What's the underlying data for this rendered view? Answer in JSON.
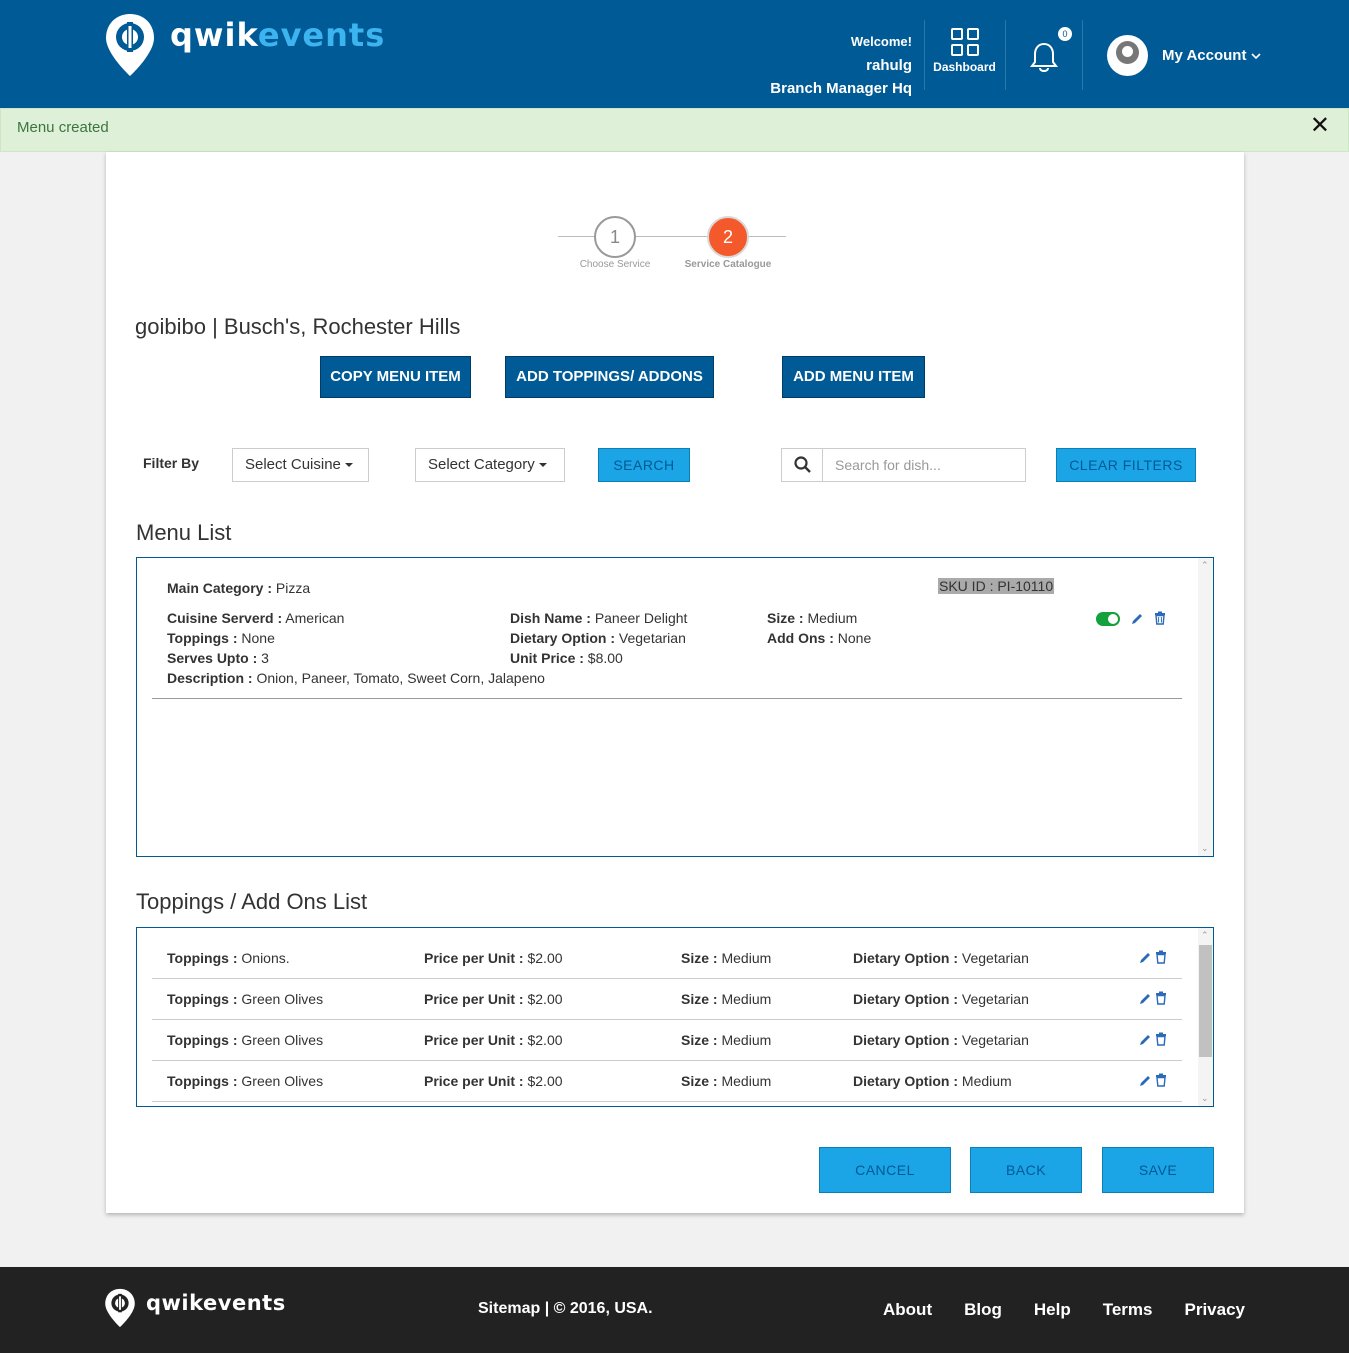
{
  "brand": {
    "name_part1": "qwik",
    "name_part2": "events"
  },
  "header": {
    "welcome": "Welcome!",
    "username": "rahulg",
    "role": "Branch Manager Hq",
    "dashboard_label": "Dashboard",
    "notification_count": "0",
    "account_label": "My Account"
  },
  "alert": {
    "message": "Menu created",
    "close": "✕"
  },
  "steps": [
    {
      "number": "1",
      "label": "Choose Service"
    },
    {
      "number": "2",
      "label": "Service Catalogue"
    }
  ],
  "page_title": "goibibo | Busch's, Rochester Hills",
  "actions": {
    "copy": "COPY MENU ITEM",
    "toppings": "ADD TOPPINGS/ ADDONS",
    "add": "ADD MENU ITEM"
  },
  "filters": {
    "label": "Filter By",
    "cuisine": "Select Cuisine",
    "category": "Select Category",
    "search_btn": "SEARCH",
    "search_placeholder": "Search for dish...",
    "clear": "CLEAR FILTERS"
  },
  "menu_list": {
    "title": "Menu List",
    "item": {
      "main_category_label": "Main Category :",
      "main_category": "Pizza",
      "sku": "SKU ID : PI-10110",
      "cuisine_label": "Cuisine Serverd :",
      "cuisine": "American",
      "toppings_label": "Toppings :",
      "toppings": "None",
      "serves_label": "Serves Upto :",
      "serves": "3",
      "description_label": "Description :",
      "description": "Onion, Paneer, Tomato, Sweet Corn, Jalapeno",
      "dish_label": "Dish Name :",
      "dish": "Paneer Delight",
      "dietary_label": "Dietary Option :",
      "dietary": "Vegetarian",
      "price_label": "Unit Price :",
      "price": "$8.00",
      "size_label": "Size :",
      "size": "Medium",
      "addons_label": "Add Ons :",
      "addons": "None",
      "enabled": true
    }
  },
  "toppings_list": {
    "title": "Toppings / Add Ons List",
    "labels": {
      "topping": "Toppings :",
      "price": "Price per Unit :",
      "size": "Size :",
      "dietary": "Dietary Option :"
    },
    "rows": [
      {
        "topping": "Onions.",
        "price": "$2.00",
        "size": "Medium",
        "dietary": "Vegetarian"
      },
      {
        "topping": "Green Olives",
        "price": "$2.00",
        "size": "Medium",
        "dietary": "Vegetarian"
      },
      {
        "topping": "Green Olives",
        "price": "$2.00",
        "size": "Medium",
        "dietary": "Vegetarian"
      },
      {
        "topping": "Green Olives",
        "price": "$2.00",
        "size": "Medium",
        "dietary": "Medium"
      }
    ]
  },
  "bottom": {
    "cancel": "CANCEL",
    "back": "BACK",
    "save": "SAVE"
  },
  "footer": {
    "brand": "qwikevents",
    "copyright": "Sitemap | © 2016, USA.",
    "links": [
      "About",
      "Blog",
      "Help",
      "Terms",
      "Privacy"
    ]
  },
  "colors": {
    "header_bg": "#005a96",
    "accent": "#1ba5e6",
    "step_active": "#f4592b",
    "alert_bg": "#dff0d8",
    "footer_bg": "#222222"
  }
}
